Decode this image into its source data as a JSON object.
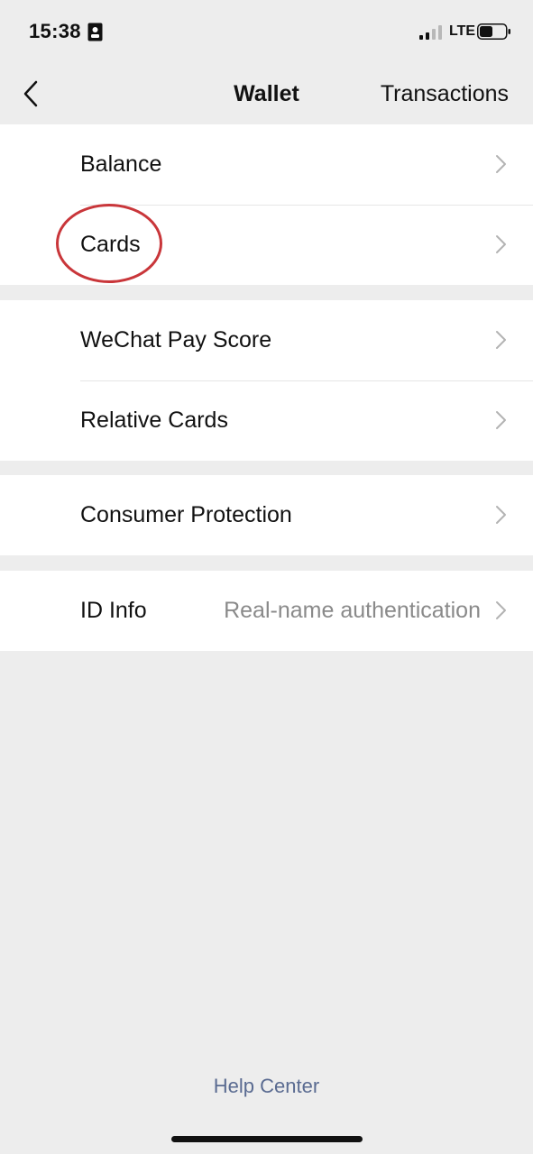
{
  "status_bar": {
    "time": "15:38",
    "network": "LTE"
  },
  "nav": {
    "title": "Wallet",
    "action": "Transactions"
  },
  "groups": [
    {
      "items": [
        {
          "label": "Balance"
        },
        {
          "label": "Cards"
        }
      ]
    },
    {
      "items": [
        {
          "label": "WeChat Pay Score"
        },
        {
          "label": "Relative Cards"
        }
      ]
    },
    {
      "items": [
        {
          "label": "Consumer Protection"
        }
      ]
    },
    {
      "items": [
        {
          "label": "ID Info",
          "value": "Real-name authentication"
        }
      ]
    }
  ],
  "footer": {
    "help": "Help Center"
  },
  "colors": {
    "background": "#ededed",
    "row_background": "#ffffff",
    "annotation_circle": "#c9363a",
    "link": "#5a6b91",
    "secondary_text": "#8a8a8a"
  }
}
